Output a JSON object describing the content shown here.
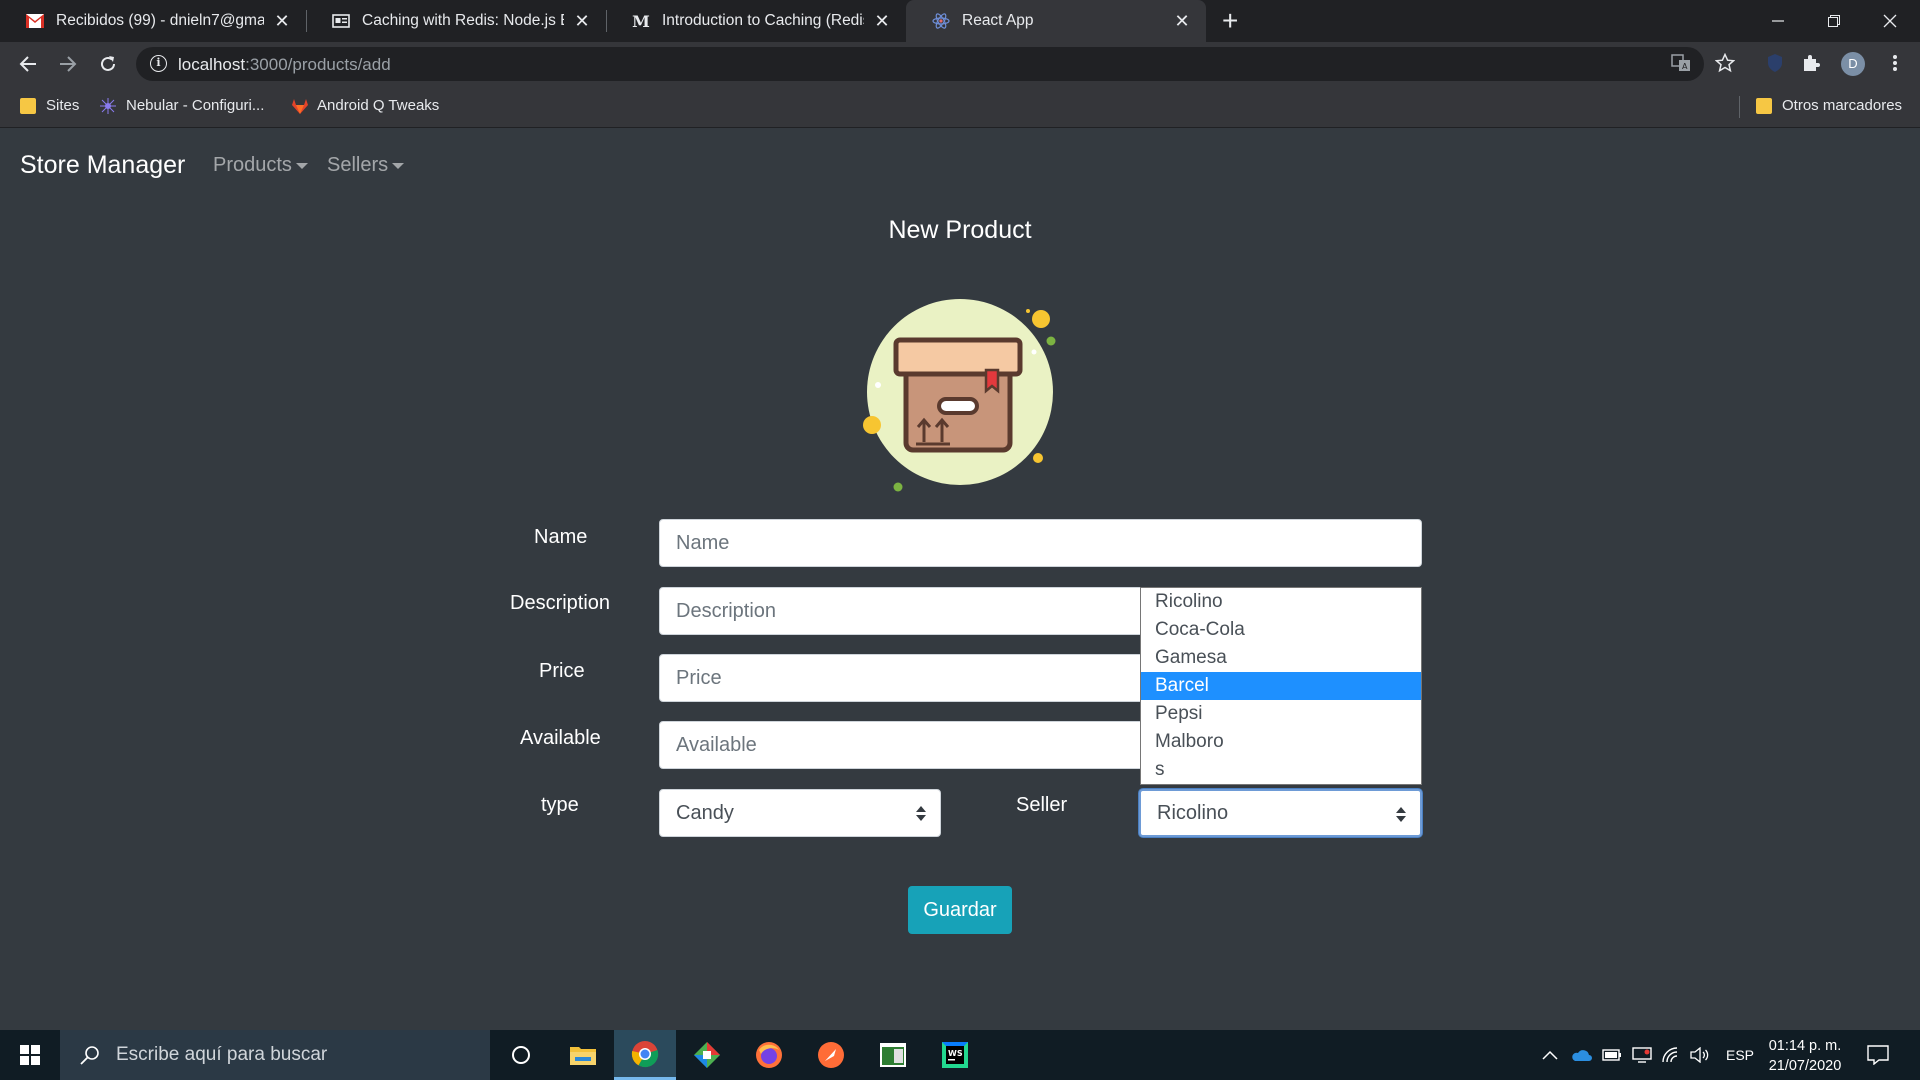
{
  "browser": {
    "tabs": [
      {
        "title": "Recibidos (99) - dnieln7@gmail.c",
        "icon": "gmail-icon"
      },
      {
        "title": "Caching with Redis: Node.js Exam",
        "icon": "article-icon"
      },
      {
        "title": "Introduction to Caching (Redis +",
        "icon": "medium-icon"
      },
      {
        "title": "React App",
        "icon": "react-icon"
      }
    ],
    "url_host": "localhost",
    "url_path": ":3000/products/add",
    "profile_initial": "D",
    "bookmarks": [
      {
        "label": "Sites"
      },
      {
        "label": "Nebular - Configuri..."
      },
      {
        "label": "Android Q Tweaks"
      }
    ],
    "other_bookmarks": "Otros marcadores"
  },
  "app": {
    "brand": "Store Manager",
    "nav": {
      "products": "Products",
      "sellers": "Sellers"
    },
    "heading": "New Product",
    "form": {
      "name_label": "Name",
      "name_placeholder": "Name",
      "description_label": "Description",
      "description_placeholder": "Description",
      "price_label": "Price",
      "price_placeholder": "Price",
      "available_label": "Available",
      "available_placeholder": "Available",
      "type_label": "type",
      "type_value": "Candy",
      "seller_label": "Seller",
      "seller_value": "Ricolino",
      "seller_options": [
        "Ricolino",
        "Coca-Cola",
        "Gamesa",
        "Barcel",
        "Pepsi",
        "Malboro",
        "s"
      ],
      "seller_highlighted": "Barcel",
      "save_label": "Guardar"
    }
  },
  "taskbar": {
    "search_placeholder": "Escribe aquí para buscar",
    "language": "ESP",
    "time": "01:14 p. m.",
    "date": "21/07/2020"
  }
}
